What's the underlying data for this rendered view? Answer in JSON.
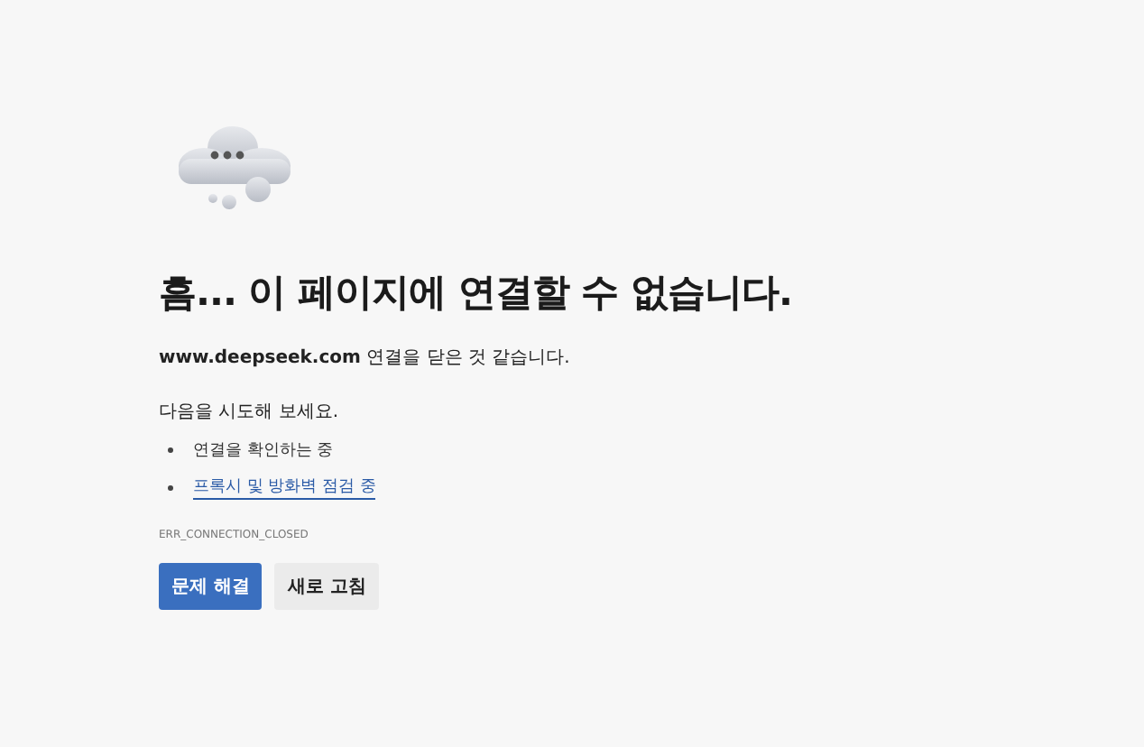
{
  "heading": "흠... 이 페이지에 연결할 수 없습니다.",
  "message": "**www.deepseek.com** 연결을 닫은 것 같습니다.",
  "suggestion_title": "다음을 시도해 보세요.",
  "suggestions": [
    {
      "kind": "text",
      "text": "연결을 확인하는 중"
    },
    {
      "kind": "link",
      "text": "프록시 및 방화벽 점검 중"
    }
  ],
  "error_code": "ERR_CONNECTION_CLOSED",
  "buttons": [
    {
      "label": "문제 해결",
      "primary": true
    },
    {
      "label": "새로 고침",
      "primary": false
    }
  ]
}
